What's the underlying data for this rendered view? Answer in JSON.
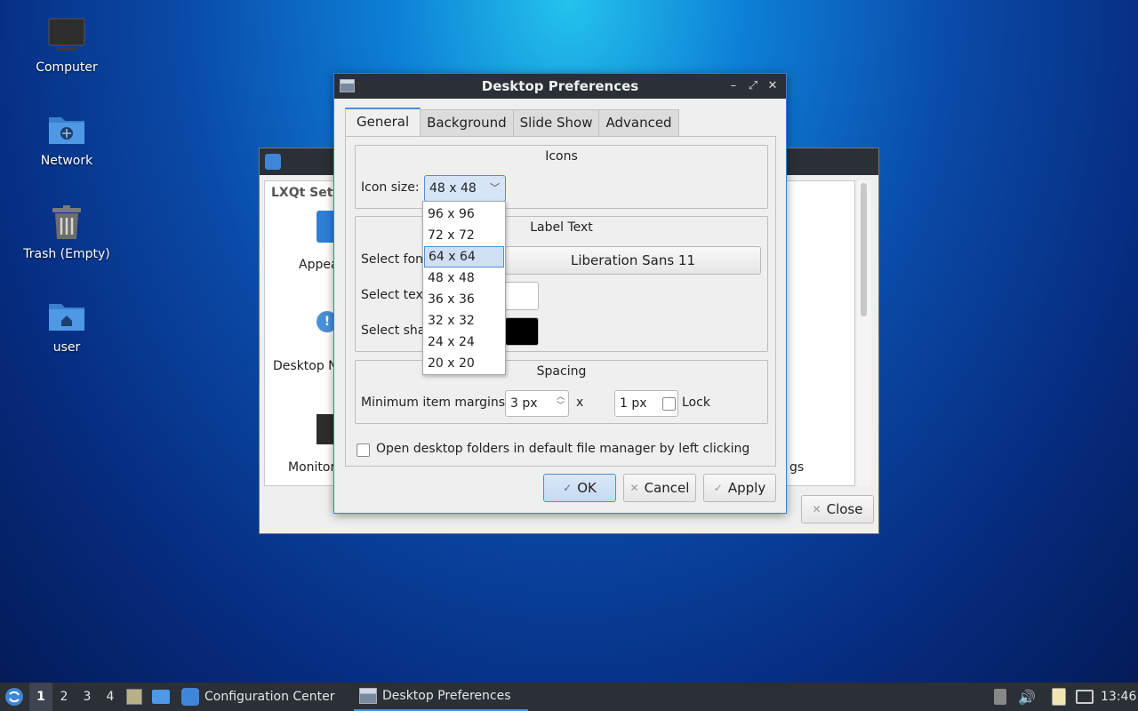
{
  "desktop": {
    "icons": [
      {
        "label": "Computer"
      },
      {
        "label": "Network"
      },
      {
        "label": "Trash (Empty)"
      },
      {
        "label": "user"
      }
    ]
  },
  "config_center": {
    "header": "LXQt Setti",
    "items": [
      "Appea",
      "Desktop N",
      "Monitor",
      "gs"
    ],
    "close_label": "Close"
  },
  "dialog": {
    "title": "Desktop Preferences",
    "tabs": [
      "General",
      "Background",
      "Slide Show",
      "Advanced"
    ],
    "icons_group": {
      "title": "Icons",
      "icon_size_label": "Icon size:",
      "icon_size_value": "48 x 48",
      "options": [
        "96 x 96",
        "72 x 72",
        "64 x 64",
        "48 x 48",
        "36 x 36",
        "32 x 32",
        "24 x 24",
        "20 x 20"
      ],
      "highlighted": "64 x 64"
    },
    "label_group": {
      "title": "Label Text",
      "font_label": "Select font",
      "font_value": "Liberation Sans 11",
      "text_color_label": "Select text",
      "shadow_label": "Select sha",
      "text_color": "#ffffff",
      "shadow_color": "#000000"
    },
    "spacing_group": {
      "title": "Spacing",
      "margins_label": "Minimum item margins:",
      "margin_x": "3 px",
      "times": "x",
      "margin_y": "1 px",
      "lock_label": "Lock"
    },
    "open_folders_label": "Open desktop folders in default file manager by left clicking",
    "ok_label": "OK",
    "cancel_label": "Cancel",
    "apply_label": "Apply"
  },
  "taskbar": {
    "desktops": [
      "1",
      "2",
      "3",
      "4"
    ],
    "tasks": [
      "Configuration Center",
      "Desktop Preferences"
    ],
    "clock": "13:46"
  },
  "colors": {
    "accent": "#4a90d9",
    "titlebar": "#2b2f36"
  }
}
